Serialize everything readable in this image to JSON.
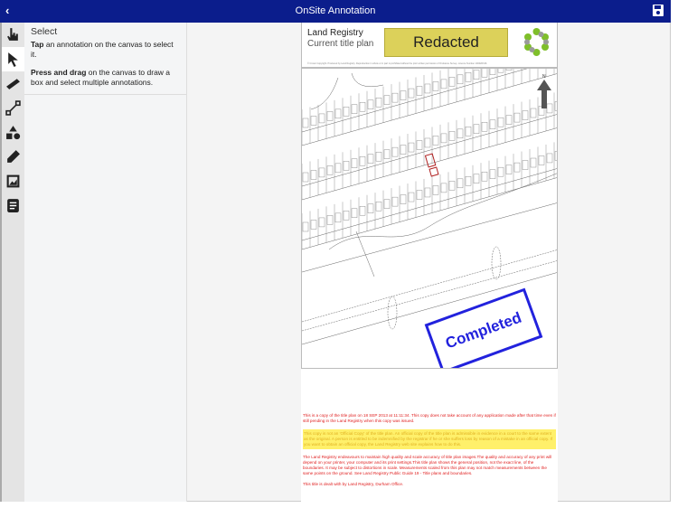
{
  "header": {
    "title": "OnSite Annotation",
    "back_icon": "chevron-left-icon",
    "save_icon": "save-icon"
  },
  "toolbar": {
    "tools": [
      "pan",
      "select",
      "measure",
      "line",
      "shapes",
      "pen",
      "image",
      "notes"
    ],
    "selected": "select"
  },
  "panel": {
    "title": "Select",
    "tap_bold": "Tap",
    "tap_text": " an annotation on the canvas to select it.",
    "drag_bold": "Press and drag",
    "drag_text": " on the canvas to draw a box and select multiple annotations."
  },
  "document": {
    "brand_line1": "Land Registry",
    "brand_line2": "Current title plan",
    "redacted": "Redacted",
    "copyright": "© Crown Copyright. Produced by Land Registry. Reproduction in whole or in part is prohibited without the prior written permission of Ordnance Survey. Licence Number 100026316.",
    "north": "N",
    "stamp": "Completed",
    "notes": [
      "This is a copy of the title plan on 18 SEP 2013 at 11:11:34. This copy does not take account of any application made after that time even if still pending in the Land Registry when this copy was issued.",
      "This copy is not an 'Official Copy' of the title plan. An official copy of the title plan is admissible in evidence in a court to the same extent as the original. A person is entitled to be indemnified by the registrar if he or she suffers loss by reason of a mistake in an official copy. If you want to obtain an official copy, the Land Registry web site explains how to do this.",
      "The Land Registry endeavours to maintain high quality and scale accuracy of title plan images.The quality and accuracy of any print will depend on your printer, your computer and its print settings.This title plan shows the general position, not the exact line, of the boundaries.  It may be subject to distortions in scale.  Measurements scaled from this plan may not match measurements between the same points on the ground.  See Land Registry  Public Guide 19 - Title plans and boundaries.",
      "This title is dealt with by Land Registry, Durham Office."
    ]
  }
}
